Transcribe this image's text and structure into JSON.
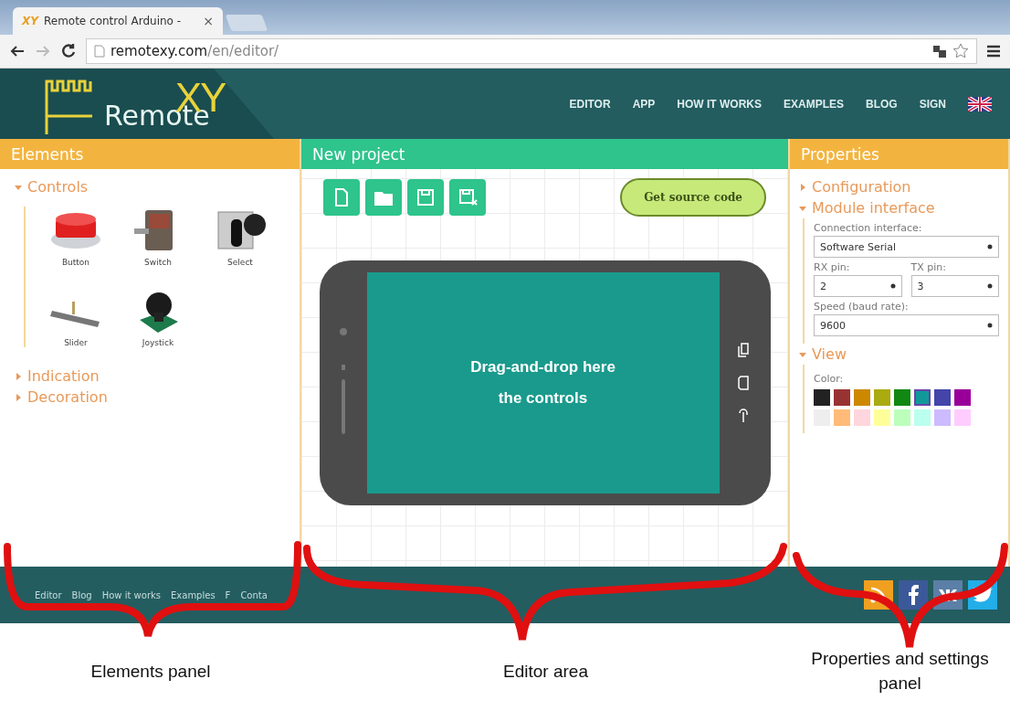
{
  "browser": {
    "tab_icon": "XY",
    "tab_title": "Remote control Arduino -",
    "tab_close": "×",
    "url_host": "remotexy.com",
    "url_path": "/en/editor/"
  },
  "header": {
    "logo_text": "Remote",
    "logo_mark": "XY",
    "nav": [
      "EDITOR",
      "APP",
      "HOW IT WORKS",
      "EXAMPLES",
      "BLOG",
      "SIGN"
    ]
  },
  "elements_panel": {
    "title": "Elements",
    "sections": [
      {
        "label": "Controls",
        "expanded": true,
        "items": [
          {
            "label": "Button",
            "kind": "button"
          },
          {
            "label": "Switch",
            "kind": "switch"
          },
          {
            "label": "Select",
            "kind": "select"
          },
          {
            "label": "Slider",
            "kind": "slider"
          },
          {
            "label": "Joystick",
            "kind": "joystick"
          }
        ]
      },
      {
        "label": "Indication",
        "expanded": false
      },
      {
        "label": "Decoration",
        "expanded": false
      }
    ]
  },
  "editor": {
    "title": "New project",
    "tools": [
      {
        "kind": "new"
      },
      {
        "kind": "open"
      },
      {
        "kind": "save"
      },
      {
        "kind": "save-as"
      }
    ],
    "source_button": "Get source code",
    "drop_hint": [
      "Drag-and-drop here",
      "the controls"
    ]
  },
  "properties_panel": {
    "title": "Properties",
    "sections": [
      {
        "kind": "plain",
        "label": "Configuration",
        "expanded": false
      },
      {
        "kind": "module",
        "label": "Module interface",
        "expanded": true,
        "fields": [
          {
            "kind": "full",
            "label": "Connection interface:",
            "value": "Software Serial"
          },
          {
            "kind": "half",
            "label": "RX pin:",
            "value": "2"
          },
          {
            "kind": "half",
            "label": "TX pin:",
            "value": "3"
          },
          {
            "kind": "full",
            "label": "Speed (baud rate):",
            "value": "9600"
          }
        ]
      },
      {
        "kind": "view",
        "label": "View",
        "expanded": true,
        "color_label": "Color:",
        "colors": [
          {
            "color": "#222222",
            "selected": false
          },
          {
            "color": "#993333",
            "selected": false
          },
          {
            "color": "#cc8800",
            "selected": false
          },
          {
            "color": "#aaaa11",
            "selected": false
          },
          {
            "color": "#118811",
            "selected": false
          },
          {
            "color": "#119999",
            "selected": true
          },
          {
            "color": "#4444aa",
            "selected": false
          },
          {
            "color": "#990099",
            "selected": false
          },
          {
            "color": "#eeeeee",
            "selected": false
          },
          {
            "color": "#ffbb77",
            "selected": false
          },
          {
            "color": "#ffd6dd",
            "selected": false
          },
          {
            "color": "#ffff99",
            "selected": false
          },
          {
            "color": "#bbffbb",
            "selected": false
          },
          {
            "color": "#bbffee",
            "selected": false
          },
          {
            "color": "#ccbbff",
            "selected": false
          },
          {
            "color": "#ffccff",
            "selected": false
          }
        ]
      }
    ]
  },
  "footer": {
    "links": [
      "Editor",
      "Blog",
      "How it works",
      "Examples",
      "F",
      "Conta"
    ],
    "social": [
      {
        "kind": "rss"
      },
      {
        "kind": "facebook"
      },
      {
        "kind": "vk"
      },
      {
        "kind": "twitter"
      }
    ]
  },
  "annotations": [
    "Elements panel",
    "Editor area",
    "Properties and settings panel"
  ]
}
